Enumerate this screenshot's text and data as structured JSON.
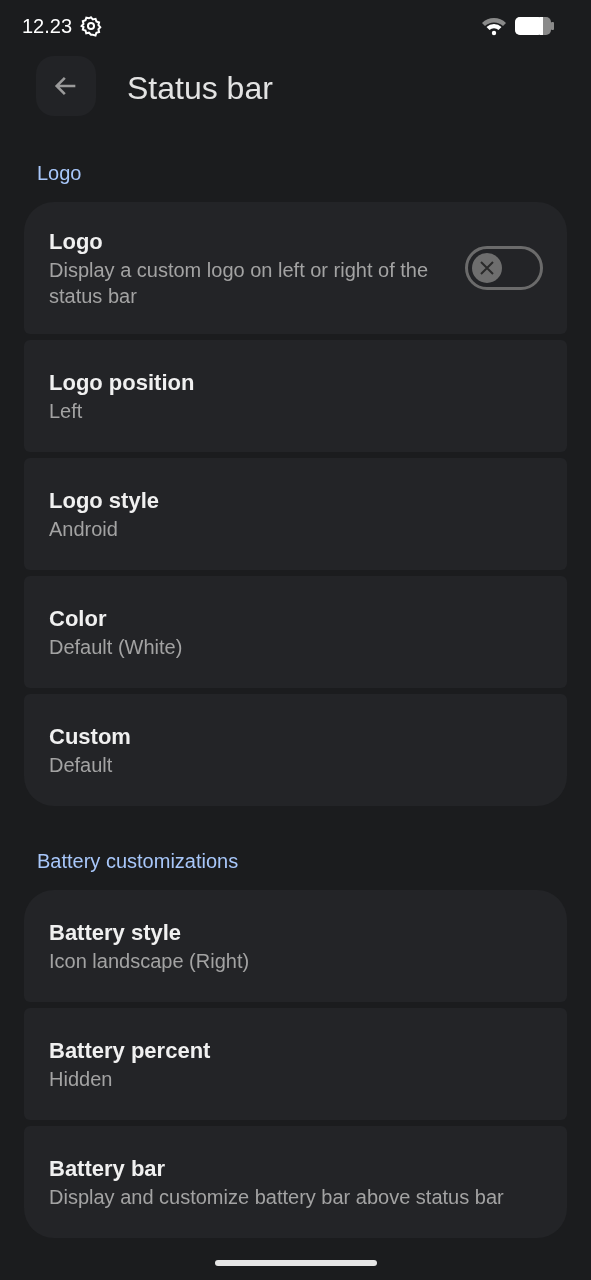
{
  "status_bar": {
    "time": "12.23"
  },
  "header": {
    "title": "Status bar"
  },
  "sections": [
    {
      "title": "Logo",
      "items": [
        {
          "kind": "switch",
          "title": "Logo",
          "summary": "Display a custom logo on left or right of the status bar",
          "on": false
        },
        {
          "kind": "plain",
          "title": "Logo position",
          "summary": "Left"
        },
        {
          "kind": "plain",
          "title": "Logo style",
          "summary": "Android"
        },
        {
          "kind": "plain",
          "title": "Color",
          "summary": "Default (White)"
        },
        {
          "kind": "plain",
          "title": "Custom",
          "summary": "Default"
        }
      ]
    },
    {
      "title": "Battery customizations",
      "items": [
        {
          "kind": "plain",
          "title": "Battery style",
          "summary": "Icon landscape (Right)"
        },
        {
          "kind": "plain",
          "title": "Battery percent",
          "summary": "Hidden"
        },
        {
          "kind": "plain",
          "title": "Battery bar",
          "summary": "Display and customize battery bar above status bar"
        }
      ]
    }
  ]
}
